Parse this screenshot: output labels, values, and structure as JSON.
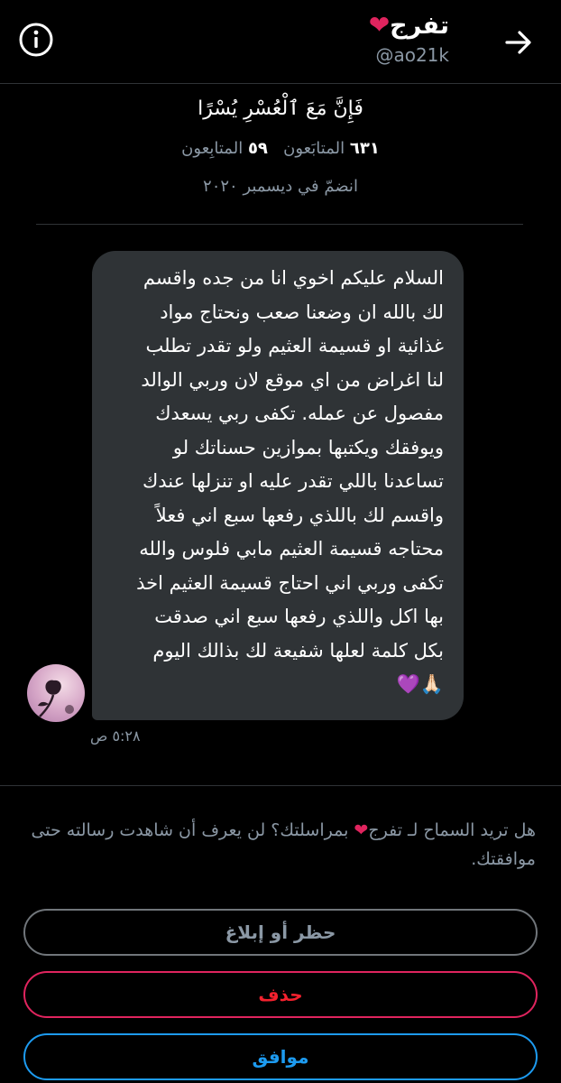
{
  "header": {
    "title": "تفرج",
    "title_emoji": "❤",
    "handle": "@ao21k",
    "info_icon": "info-circle-icon",
    "back_icon": "arrow-right-icon"
  },
  "profile": {
    "bio": "فَإِنَّ مَعَ ٱلْعُسْرِ يُسْرًا",
    "following_count": "٦٣١",
    "following_label": "المتابَعون",
    "followers_count": "٥٩",
    "followers_label": "المتابِعون",
    "joined": "انضمّ في ديسمبر ٢٠٢٠"
  },
  "message": {
    "text": "السلام عليكم اخوي انا من جده واقسم\nلك بالله ان وضعنا صعب  ونحتاج مواد\nغذائية او قسيمة  العثيم ولو تقدر تطلب\nلنا اغراض من اي موقع   لان وربي الوالد\nمفصول عن عمله. تكفى ربي يسعدك\nويوفقك  ويكتبها بموازين حسناتك لو\nتساعدنا باللي تقدر عليه او تنزلها عندك\nواقسم لك باللذي رفعها سبع اني فعلاً\nمحتاجه قسيمة العثيم مابي فلوس والله\nتكفى وربي اني احتاج قسيمة العثيم اخذ\nبها اكل واللذي رفعها سبع اني صدقت\nبكل كلمة  لعلها شفيعة لك بذالك اليوم\n🙏🏻💜",
    "time": "٥:٢٨ ص"
  },
  "request": {
    "text_before": "هل تريد السماح لـ تفرج",
    "heart": "❤",
    "text_after": " بمراسلتك؟ لن يعرف أن شاهدت رسالته حتى موافقتك."
  },
  "actions": {
    "block_label": "حظر أو إبلاغ",
    "delete_label": "حذف",
    "accept_label": "موافق"
  },
  "colors": {
    "background": "#000000",
    "bubble": "#2f3336",
    "accent_blue": "#1d9bf0",
    "danger_red": "#f4212e",
    "muted": "#8b98a5"
  }
}
